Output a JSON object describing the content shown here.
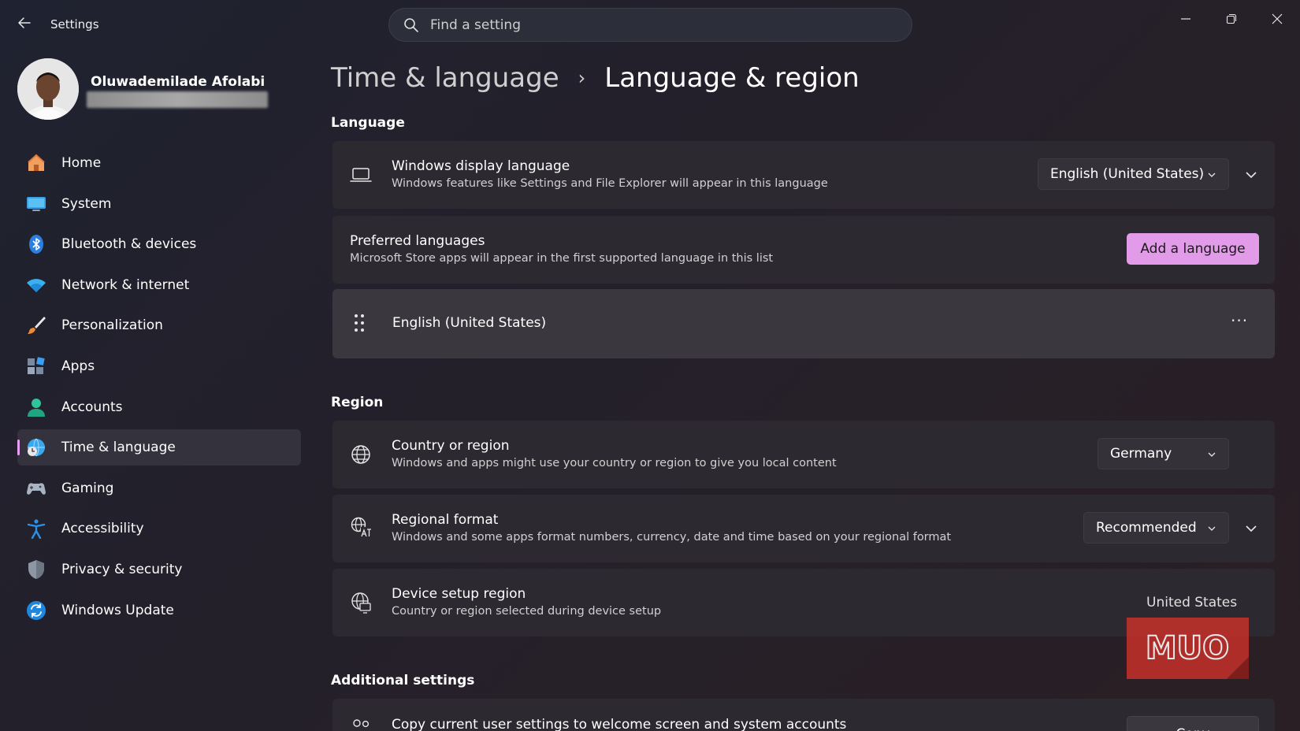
{
  "window": {
    "title": "Settings",
    "back_icon": "arrow-left-icon"
  },
  "search": {
    "placeholder": "Find a setting",
    "value": ""
  },
  "profile": {
    "name": "Oluwademilade Afolabi",
    "email_redacted": true
  },
  "sidebar": {
    "items": [
      {
        "label": "Home",
        "icon": "home-icon",
        "active": false
      },
      {
        "label": "System",
        "icon": "system-icon",
        "active": false
      },
      {
        "label": "Bluetooth & devices",
        "icon": "bluetooth-icon",
        "active": false
      },
      {
        "label": "Network & internet",
        "icon": "wifi-icon",
        "active": false
      },
      {
        "label": "Personalization",
        "icon": "brush-icon",
        "active": false
      },
      {
        "label": "Apps",
        "icon": "apps-icon",
        "active": false
      },
      {
        "label": "Accounts",
        "icon": "accounts-icon",
        "active": false
      },
      {
        "label": "Time & language",
        "icon": "time-language-icon",
        "active": true
      },
      {
        "label": "Gaming",
        "icon": "gamepad-icon",
        "active": false
      },
      {
        "label": "Accessibility",
        "icon": "accessibility-icon",
        "active": false
      },
      {
        "label": "Privacy & security",
        "icon": "shield-icon",
        "active": false
      },
      {
        "label": "Windows Update",
        "icon": "update-icon",
        "active": false
      }
    ]
  },
  "breadcrumb": {
    "parent": "Time & language",
    "separator": "›",
    "current": "Language & region"
  },
  "language": {
    "section_title": "Language",
    "display_language": {
      "title": "Windows display language",
      "subtitle": "Windows features like Settings and File Explorer will appear in this language",
      "selected": "English (United States)"
    },
    "preferred": {
      "title": "Preferred languages",
      "subtitle": "Microsoft Store apps will appear in the first supported language in this list",
      "add_button": "Add a language"
    },
    "language_list": [
      {
        "label": "English (United States)",
        "more": "···"
      }
    ]
  },
  "region": {
    "section_title": "Region",
    "country": {
      "title": "Country or region",
      "subtitle": "Windows and apps might use your country or region to give you local content",
      "selected": "Germany"
    },
    "format": {
      "title": "Regional format",
      "subtitle": "Windows and some apps format numbers, currency, date and time based on your regional format",
      "selected": "Recommended"
    },
    "device_setup": {
      "title": "Device setup region",
      "subtitle": "Country or region selected during device setup",
      "value": "United States"
    }
  },
  "additional": {
    "section_title": "Additional settings",
    "copy_settings": {
      "title": "Copy current user settings to welcome screen and system accounts",
      "button": "Copy"
    }
  },
  "watermark": {
    "text": "MUO"
  },
  "colors": {
    "accent": "#e29be8",
    "background": "#24202a",
    "card": "#2c2a30"
  }
}
